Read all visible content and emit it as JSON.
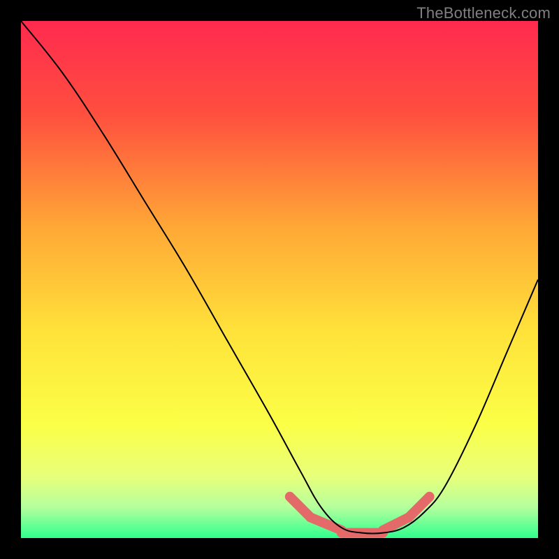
{
  "watermark": "TheBottleneck.com",
  "chart_data": {
    "type": "line",
    "title": "",
    "xlabel": "",
    "ylabel": "",
    "xlim": [
      0,
      100
    ],
    "ylim": [
      0,
      100
    ],
    "grid": false,
    "background_gradient": {
      "stops": [
        {
          "offset": 0.0,
          "color": "#ff2a4f"
        },
        {
          "offset": 0.18,
          "color": "#ff4f3f"
        },
        {
          "offset": 0.4,
          "color": "#ffa836"
        },
        {
          "offset": 0.6,
          "color": "#ffe23a"
        },
        {
          "offset": 0.78,
          "color": "#fbff46"
        },
        {
          "offset": 0.88,
          "color": "#e8ff7a"
        },
        {
          "offset": 0.94,
          "color": "#b6ff9d"
        },
        {
          "offset": 1.0,
          "color": "#2fff8e"
        }
      ]
    },
    "series": [
      {
        "name": "curve",
        "color": "#000000",
        "x": [
          0,
          8,
          16,
          24,
          32,
          40,
          48,
          54,
          58,
          62,
          66,
          70,
          74,
          78,
          82,
          88,
          94,
          100
        ],
        "y": [
          100,
          90,
          78,
          65,
          52,
          38,
          24,
          13,
          6,
          2,
          1,
          1,
          2,
          5,
          10,
          22,
          36,
          50
        ]
      }
    ],
    "highlight": {
      "name": "trough-band",
      "color": "#e46a6a",
      "segments": [
        {
          "x": [
            52,
            56
          ],
          "y": [
            8,
            4
          ]
        },
        {
          "x": [
            56,
            62
          ],
          "y": [
            4,
            1.5
          ]
        },
        {
          "x": [
            62,
            70
          ],
          "y": [
            1,
            1
          ]
        },
        {
          "x": [
            70,
            75
          ],
          "y": [
            1.5,
            4
          ]
        },
        {
          "x": [
            75,
            79
          ],
          "y": [
            4,
            8
          ]
        }
      ]
    }
  }
}
